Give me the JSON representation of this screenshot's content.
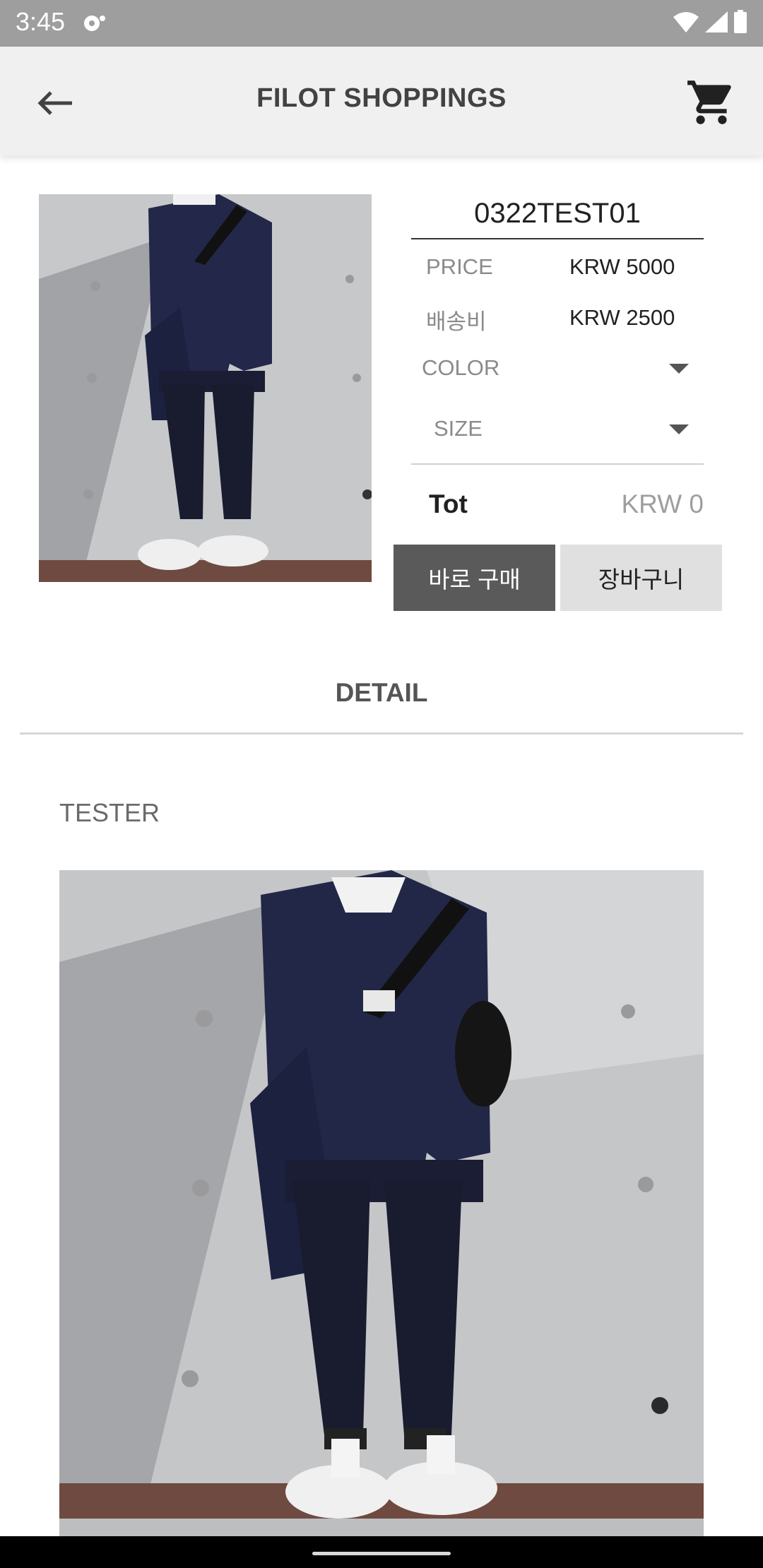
{
  "status_bar": {
    "time": "3:45"
  },
  "app_bar": {
    "title": "FILOT SHOPPINGS"
  },
  "product": {
    "name": "0322TEST01",
    "price_label": "PRICE",
    "price_value": "KRW 5000",
    "shipping_label": "배송비",
    "shipping_value": "KRW 2500",
    "color_label": "COLOR",
    "size_label": "SIZE",
    "total_label": "Tot",
    "total_value": "KRW 0",
    "buy_now_label": "바로 구매",
    "add_to_cart_label": "장바구니"
  },
  "detail": {
    "heading": "DETAIL",
    "text": "TESTER"
  },
  "icons": [
    "wifi-icon",
    "signal-icon",
    "battery-icon",
    "back-arrow-icon",
    "cart-icon",
    "dropdown-arrow-icon"
  ]
}
